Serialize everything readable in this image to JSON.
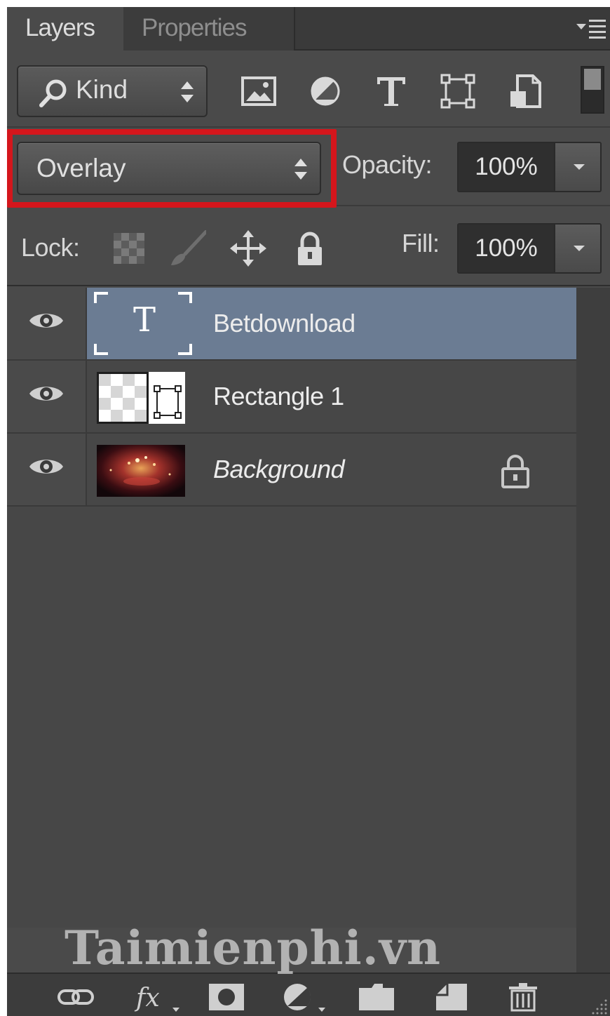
{
  "tabs": [
    {
      "label": "Layers",
      "active": true
    },
    {
      "label": "Properties",
      "active": false
    }
  ],
  "filter": {
    "kind_label": "Kind",
    "icons": [
      "image-filter-icon",
      "adjustment-filter-icon",
      "type-filter-icon",
      "shape-filter-icon",
      "smart-object-filter-icon"
    ]
  },
  "blend": {
    "mode": "Overlay",
    "highlight_color": "#d4161c",
    "opacity_label": "Opacity:",
    "opacity_value": "100%"
  },
  "lock": {
    "label": "Lock:",
    "icons": [
      "lock-transparent-pixels-icon",
      "lock-image-pixels-icon",
      "lock-position-icon",
      "lock-all-icon"
    ],
    "fill_label": "Fill:",
    "fill_value": "100%"
  },
  "layers": [
    {
      "name": "Betdownload",
      "type": "text",
      "selected": true,
      "visible": true,
      "locked": false,
      "italic": false
    },
    {
      "name": "Rectangle 1",
      "type": "shape",
      "selected": false,
      "visible": true,
      "locked": false,
      "italic": false
    },
    {
      "name": "Background",
      "type": "image",
      "selected": false,
      "visible": true,
      "locked": true,
      "italic": true
    }
  ],
  "watermark": "Taimienphi.vn",
  "footer_icons": [
    "link-layers-icon",
    "layer-style-fx-icon",
    "add-mask-icon",
    "adjustment-layer-icon",
    "new-group-icon",
    "new-layer-icon",
    "delete-layer-icon"
  ],
  "colors": {
    "panel_bg": "#4a4a4a",
    "selected_row": "#6b7c93",
    "highlight": "#d4161c"
  }
}
